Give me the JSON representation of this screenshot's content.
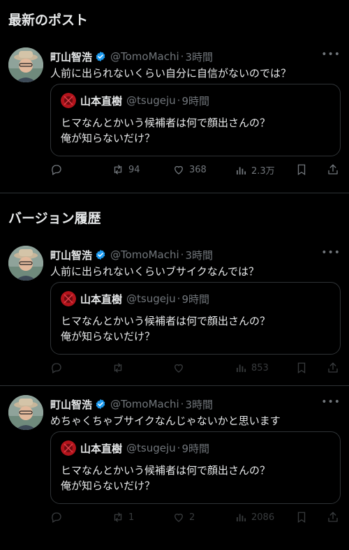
{
  "sections": {
    "latest_title": "最新のポスト",
    "history_title": "バージョン履歴"
  },
  "posts": [
    {
      "author_name": "町山智浩",
      "author_handle": "@TomoMachi",
      "time": "3時間",
      "text": "人前に出られないくらい自分に自信がないのでは？",
      "quote": {
        "name": "山本直樹",
        "handle": "@tsugeju",
        "time": "9時間",
        "line1": "ヒマなんとかいう候補者は何で顔出さんの？",
        "line2": "俺が知らないだけ？"
      },
      "actions": {
        "replies": "",
        "reposts": "94",
        "likes": "368",
        "views": "2.3万"
      }
    },
    {
      "author_name": "町山智浩",
      "author_handle": "@TomoMachi",
      "time": "3時間",
      "text": "人前に出られないくらいブサイクなんでは？",
      "quote": {
        "name": "山本直樹",
        "handle": "@tsugeju",
        "time": "9時間",
        "line1": "ヒマなんとかいう候補者は何で顔出さんの？",
        "line2": "俺が知らないだけ？"
      },
      "actions": {
        "replies": "",
        "reposts": "",
        "likes": "",
        "views": "853"
      }
    },
    {
      "author_name": "町山智浩",
      "author_handle": "@TomoMachi",
      "time": "3時間",
      "text": "めちゃくちゃブサイクなんじゃないかと思います",
      "quote": {
        "name": "山本直樹",
        "handle": "@tsugeju",
        "time": "9時間",
        "line1": "ヒマなんとかいう候補者は何で顔出さんの？",
        "line2": "俺が知らないだけ？"
      },
      "actions": {
        "replies": "",
        "reposts": "1",
        "likes": "2",
        "views": "2086"
      }
    }
  ],
  "colors": {
    "background": "#000000",
    "text": "#e7e9ea",
    "muted": "#71767b",
    "border": "#2f3336",
    "verified": "#1d9bf0"
  },
  "icons": [
    "verified-badge-icon",
    "more-icon",
    "reply-icon",
    "repost-icon",
    "like-icon",
    "views-icon",
    "bookmark-icon",
    "share-icon"
  ]
}
